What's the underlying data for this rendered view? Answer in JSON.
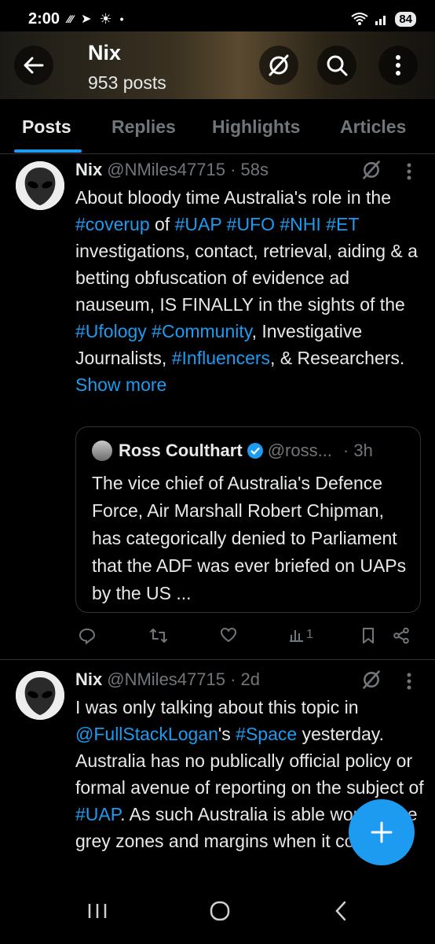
{
  "status_bar": {
    "time": "2:00",
    "battery": "84"
  },
  "header": {
    "title": "Nix",
    "subtitle": "953 posts"
  },
  "tabs": [
    {
      "label": "Posts",
      "active": true
    },
    {
      "label": "Replies"
    },
    {
      "label": "Highlights"
    },
    {
      "label": "Articles"
    }
  ],
  "posts": [
    {
      "author": "Nix",
      "handle": "@NMiles47715 · 58s",
      "text_parts": [
        {
          "t": "About bloody time Australia's role in the "
        },
        {
          "t": "#coverup",
          "tag": true
        },
        {
          "t": " of "
        },
        {
          "t": "#UAP",
          "tag": true
        },
        {
          "t": " "
        },
        {
          "t": "#UFO",
          "tag": true
        },
        {
          "t": " "
        },
        {
          "t": "#NHI",
          "tag": true
        },
        {
          "t": " "
        },
        {
          "t": "#ET",
          "tag": true
        },
        {
          "t": " investigations, contact, retrieval, aiding & a betting obfuscation of evidence ad nauseum, IS FINALLY in the sights of the "
        },
        {
          "t": "#Ufology",
          "tag": true
        },
        {
          "t": " "
        },
        {
          "t": "#Community",
          "tag": true
        },
        {
          "t": ", Investigative Journalists, "
        },
        {
          "t": "#Influencers",
          "tag": true
        },
        {
          "t": ", & Researchers. "
        }
      ],
      "show_more": "Show more",
      "quote": {
        "author": "Ross Coulthart",
        "handle": "@ross...",
        "time": "· 3h",
        "text": "The vice chief of Australia's Defence Force, Air Marshall Robert Chipman, has categorically denied to Parliament that the ADF was ever briefed on UAPs by the US ..."
      },
      "views": "1"
    },
    {
      "author": "Nix",
      "handle": "@NMiles47715 · 2d",
      "text_parts": [
        {
          "t": "I was only talking about this topic in "
        },
        {
          "t": "@FullStackLogan",
          "tag": true
        },
        {
          "t": "'s "
        },
        {
          "t": "#Space",
          "tag": true
        },
        {
          "t": " yesterday. Australia has no publically official policy or formal avenue of reporting on the subject of "
        },
        {
          "t": "#UAP",
          "tag": true
        },
        {
          "t": ". As such Australia is able work in the grey zones and margins when it comes to"
        }
      ]
    }
  ],
  "icons": {
    "back": "arrow-left-icon",
    "grok": "grok-slash-icon",
    "search": "search-icon",
    "more": "more-vertical-icon",
    "reply": "reply-icon",
    "repost": "repost-icon",
    "like": "heart-icon",
    "views": "analytics-icon",
    "bookmark": "bookmark-icon",
    "share": "share-icon",
    "compose": "plus-icon"
  },
  "colors": {
    "accent": "#1d9bf0",
    "muted": "#71767b",
    "text": "#e7e9ea"
  }
}
